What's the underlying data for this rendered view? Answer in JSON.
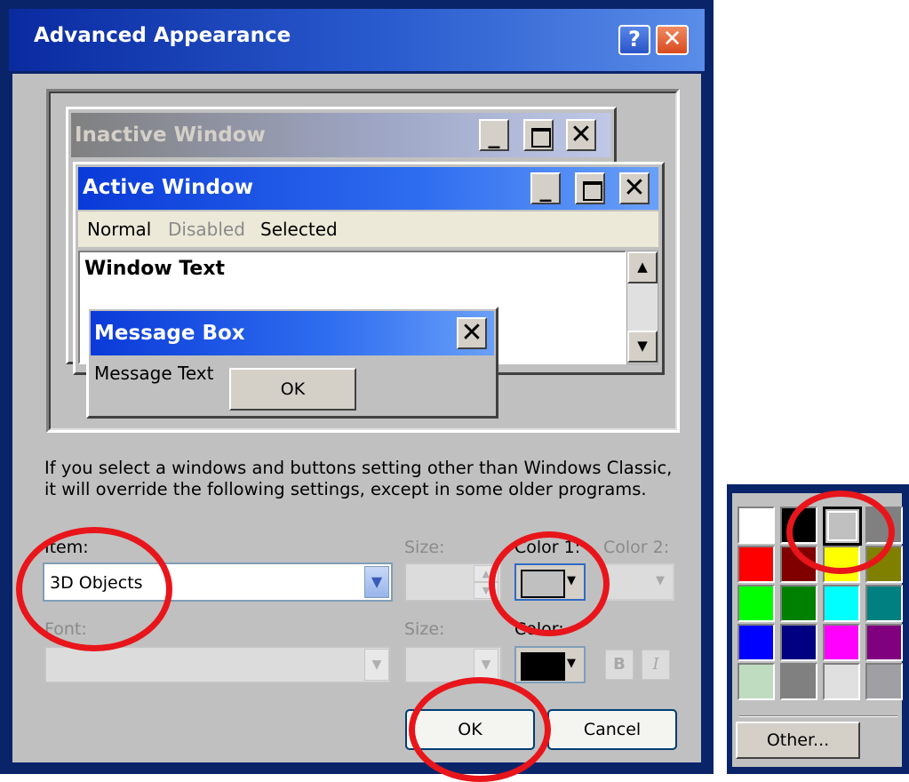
{
  "dialog": {
    "title": "Advanced Appearance",
    "help_glyph": "?",
    "close_glyph": "✕"
  },
  "preview": {
    "inactive_title": "Inactive Window",
    "active_title": "Active Window",
    "menu": {
      "normal": "Normal",
      "disabled": "Disabled",
      "selected": "Selected"
    },
    "window_text": "Window Text",
    "caption_min": "_",
    "caption_close": "✕",
    "scroll_up": "▲",
    "scroll_down": "▼",
    "message_box": {
      "title": "Message Box",
      "text": "Message Text",
      "ok": "OK",
      "close": "✕"
    }
  },
  "description": {
    "line1": "If you select a windows and buttons setting other than Windows Classic,",
    "line2": "it will override the following settings, except in some older programs."
  },
  "controls": {
    "item_label": "Item:",
    "item_value": "3D Objects",
    "size_label": "Size:",
    "color1_label": "Color 1:",
    "color2_label": "Color 2:",
    "font_label": "Font:",
    "font_size_label": "Size:",
    "font_color_label": "Color:",
    "bold_label": "B",
    "italic_label": "I",
    "combo_arrow": "▼",
    "dd_arrow": "▼",
    "spin_up": "▲",
    "spin_down": "▼"
  },
  "buttons": {
    "ok": "OK",
    "cancel": "Cancel"
  },
  "colors": {
    "color1": "#c0c0c0",
    "font_color": "#000000",
    "palette": [
      [
        "#ffffff",
        "#000000",
        "#c0c0c0",
        "#808080"
      ],
      [
        "#ff0000",
        "#800000",
        "#ffff00",
        "#808000"
      ],
      [
        "#00ff00",
        "#008000",
        "#00ffff",
        "#008080"
      ],
      [
        "#0000ff",
        "#000080",
        "#ff00ff",
        "#800080"
      ],
      [
        "#c0dcc0",
        "#808080",
        "#e0e0e0",
        "#a0a0a4"
      ]
    ],
    "palette_selected": "#c0c0c0"
  },
  "picker": {
    "other_label": "Other..."
  },
  "annotation_color": "#e8151b"
}
